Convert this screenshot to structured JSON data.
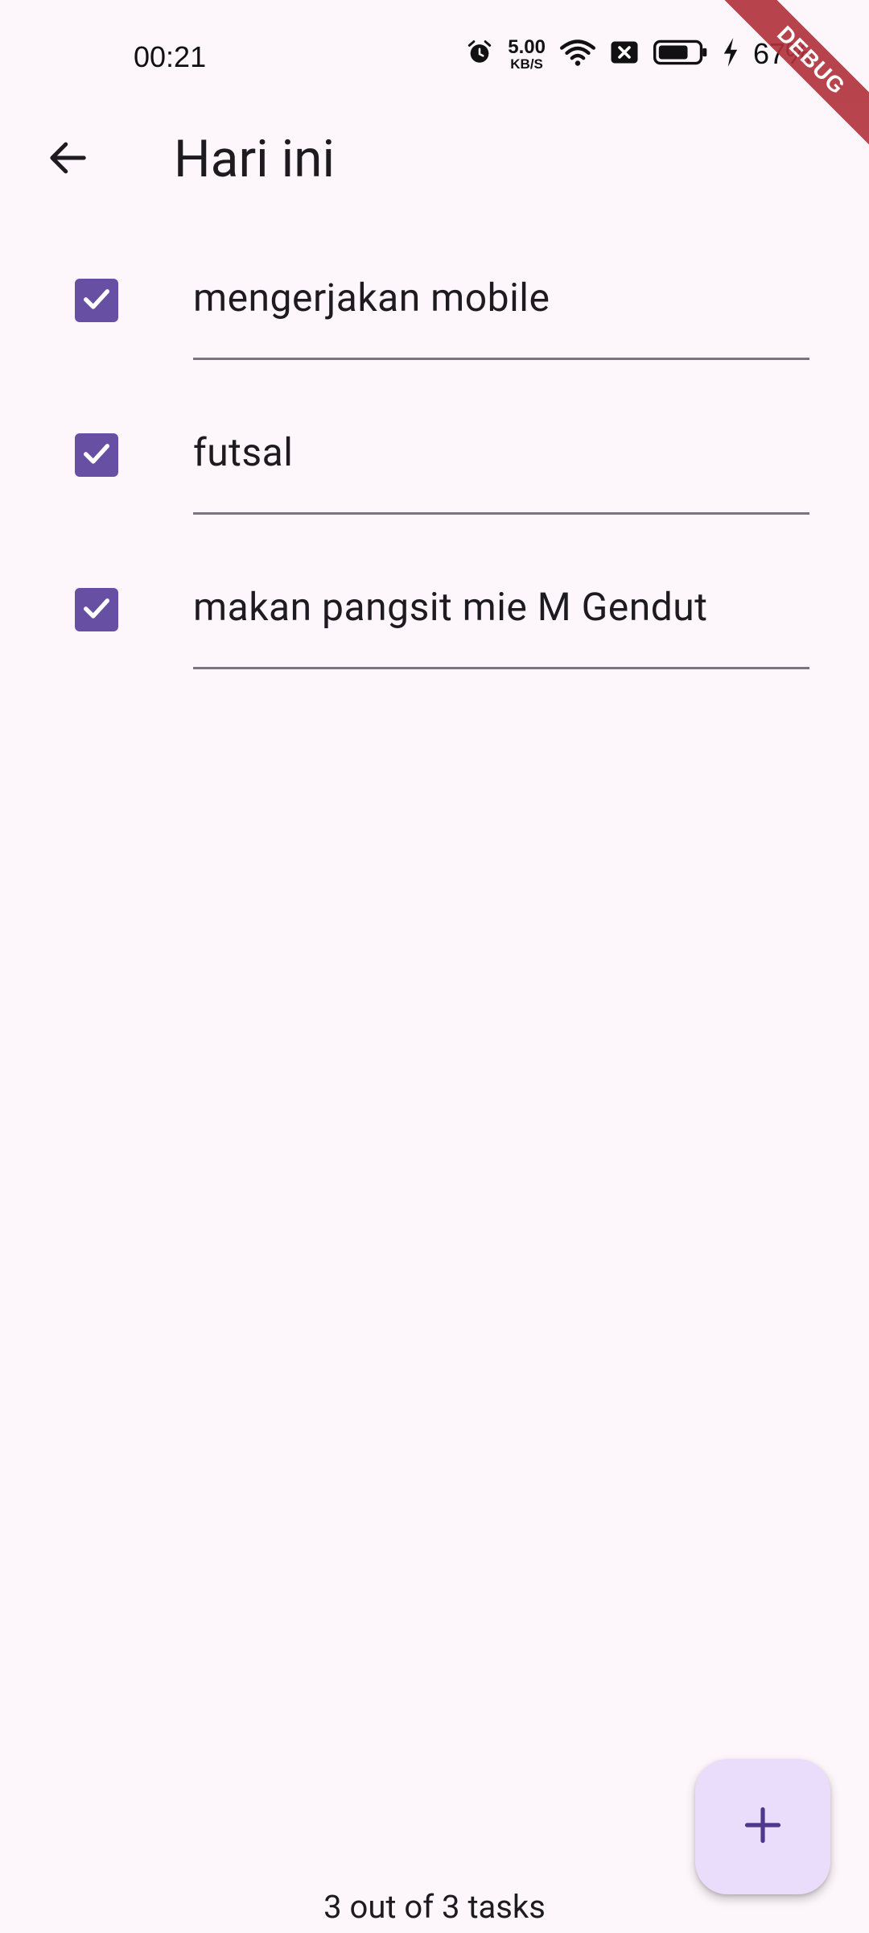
{
  "status_bar": {
    "time": "00:21",
    "net_speed_value": "5.00",
    "net_speed_unit": "KB/S",
    "battery_percent": "67%",
    "icons": [
      "alarm-icon",
      "wifi-icon",
      "sim-off-icon",
      "battery-icon",
      "charging-icon"
    ]
  },
  "debug_banner": {
    "label": "DEBUG"
  },
  "app_bar": {
    "title": "Hari ini",
    "back_icon": "arrow-back-icon"
  },
  "tasks": [
    {
      "label": "mengerjakan mobile",
      "checked": true
    },
    {
      "label": "futsal",
      "checked": true
    },
    {
      "label": "makan pangsit mie M Gendut",
      "checked": true
    }
  ],
  "fab": {
    "icon": "plus-icon"
  },
  "footer": {
    "summary": "3 out of 3 tasks"
  },
  "colors": {
    "background": "#FDF7FC",
    "checkbox": "#6750A4",
    "fab_background": "#E9DDFB",
    "fab_icon": "#4F378B",
    "underline": "#79747E",
    "debug_ribbon": "#B0303A"
  }
}
